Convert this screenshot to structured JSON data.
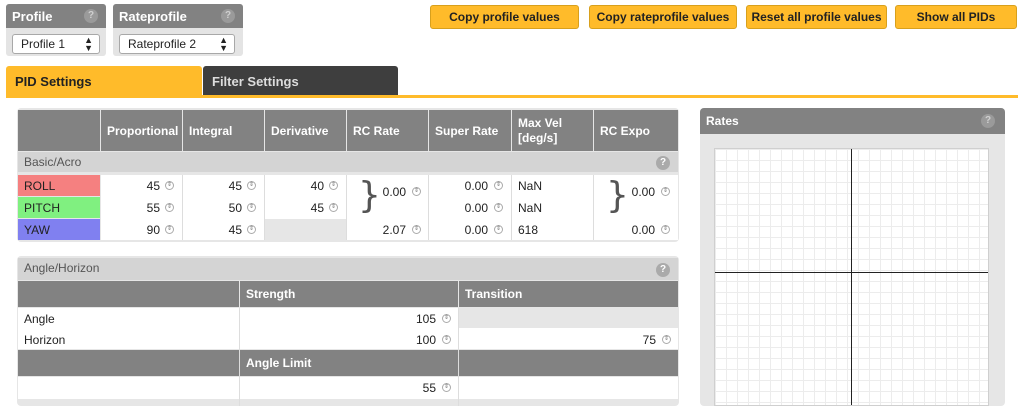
{
  "profile": {
    "title": "Profile",
    "help": "?",
    "selected": "Profile 1"
  },
  "rateprofile": {
    "title": "Rateprofile",
    "help": "?",
    "selected": "Rateprofile 2"
  },
  "actions": {
    "copy_profile": "Copy profile values",
    "copy_rateprofile": "Copy rateprofile values",
    "reset_all": "Reset all profile values",
    "show_all": "Show all PIDs"
  },
  "tabs": {
    "pid": "PID Settings",
    "filter": "Filter Settings"
  },
  "pid_table": {
    "headers": {
      "proportional": "Proportional",
      "integral": "Integral",
      "derivative": "Derivative",
      "rc_rate": "RC Rate",
      "super_rate": "Super Rate",
      "max_vel_1": "Max Vel",
      "max_vel_2": "[deg/s]",
      "rc_expo": "RC Expo"
    },
    "section": "Basic/Acro",
    "help": "?",
    "rows": [
      {
        "name": "ROLL",
        "color": "#f58080",
        "p": "45",
        "i": "45",
        "d": "40",
        "super_rate": "0.00",
        "max_vel": "NaN"
      },
      {
        "name": "PITCH",
        "color": "#80f080",
        "p": "55",
        "i": "50",
        "d": "45",
        "super_rate": "0.00",
        "max_vel": "NaN"
      },
      {
        "name": "YAW",
        "color": "#8080f0",
        "p": "90",
        "i": "45",
        "d": "",
        "super_rate": "0.00",
        "max_vel": "618"
      }
    ],
    "rc_rate_rollpitch": "0.00",
    "rc_expo_rollpitch": "0.00",
    "rc_rate_yaw": "2.07",
    "rc_expo_yaw": "0.00"
  },
  "angle_horizon": {
    "title": "Angle/Horizon",
    "help": "?",
    "strength_header": "Strength",
    "transition_header": "Transition",
    "angle_label": "Angle",
    "horizon_label": "Horizon",
    "angle_strength": "105",
    "horizon_strength": "100",
    "horizon_transition": "75",
    "angle_limit_header": "Angle Limit",
    "angle_limit": "55"
  },
  "rates": {
    "title": "Rates",
    "help": "?"
  },
  "icons": {
    "help": "question-circle-icon",
    "select_arrow": "updown-arrow-icon",
    "spinner": "spinner-icon"
  }
}
